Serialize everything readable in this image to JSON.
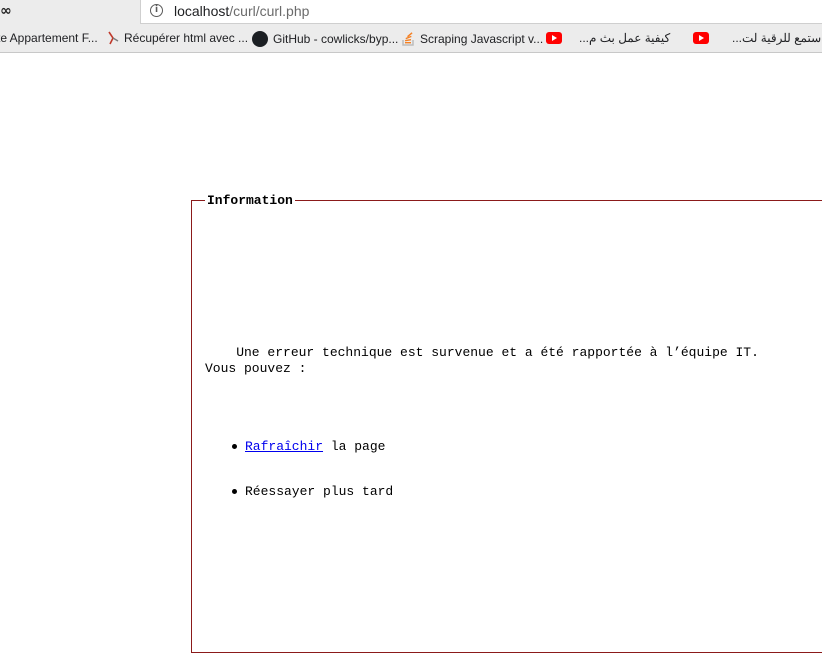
{
  "browser": {
    "url_host": "localhost",
    "url_path": "/curl/curl.php",
    "bookmarks": [
      {
        "label": "te Appartement F...",
        "icon": "page-icon"
      },
      {
        "label": "Récupérer html avec ...",
        "icon": "pen-icon"
      },
      {
        "label": "GitHub - cowlicks/byp...",
        "icon": "github-icon"
      },
      {
        "label": "Scraping Javascript v...",
        "icon": "stackoverflow-icon"
      },
      {
        "label": "كيفية عمل بث م...",
        "icon": "youtube-icon"
      },
      {
        "label": "استمع للرقية لت...",
        "icon": "youtube-icon"
      }
    ]
  },
  "info": {
    "legend": "Information",
    "message_line1": "    Une erreur technique est survenue et a été rapportée à l’équipe IT.",
    "message_line2": "Vous pouvez :",
    "options": [
      {
        "link_text": "Rafraîchir",
        "rest_text": " la page"
      },
      {
        "link_text": "",
        "rest_text": "Réessayer plus tard"
      }
    ]
  },
  "colors": {
    "fieldset_border": "#8b1a1a",
    "link": "#0000ee",
    "chrome_bg": "#ececec"
  }
}
